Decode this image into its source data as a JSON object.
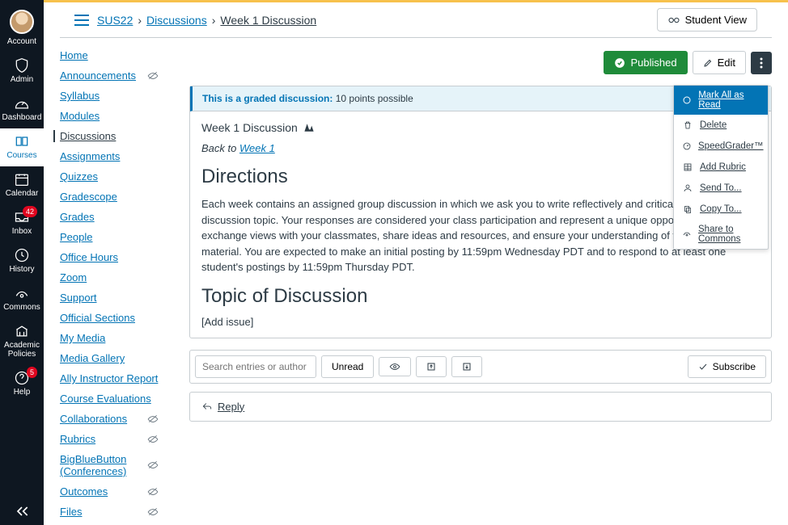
{
  "globalNav": {
    "account": "Account",
    "admin": "Admin",
    "dashboard": "Dashboard",
    "courses": "Courses",
    "calendar": "Calendar",
    "inbox": "Inbox",
    "inbox_badge": "42",
    "history": "History",
    "commons": "Commons",
    "academic": "Academic Policies",
    "help": "Help",
    "help_badge": "5"
  },
  "breadcrumbs": {
    "course": "SUS22",
    "section": "Discussions",
    "page": "Week 1 Discussion"
  },
  "studentView": "Student View",
  "courseNav": {
    "items": [
      {
        "label": "Home",
        "hidden": false
      },
      {
        "label": "Announcements",
        "hidden": true
      },
      {
        "label": "Syllabus",
        "hidden": false
      },
      {
        "label": "Modules",
        "hidden": false
      },
      {
        "label": "Discussions",
        "hidden": false,
        "active": true
      },
      {
        "label": "Assignments",
        "hidden": false
      },
      {
        "label": "Quizzes",
        "hidden": false
      },
      {
        "label": "Gradescope",
        "hidden": false
      },
      {
        "label": "Grades",
        "hidden": false
      },
      {
        "label": "People",
        "hidden": false
      },
      {
        "label": "Office Hours",
        "hidden": false
      },
      {
        "label": "Zoom",
        "hidden": false
      },
      {
        "label": "Support",
        "hidden": false
      },
      {
        "label": "Official Sections",
        "hidden": false
      },
      {
        "label": "My Media",
        "hidden": false
      },
      {
        "label": "Media Gallery",
        "hidden": false
      },
      {
        "label": "Ally Instructor Report",
        "hidden": false
      },
      {
        "label": "Course Evaluations",
        "hidden": false
      },
      {
        "label": "Collaborations",
        "hidden": true
      },
      {
        "label": "Rubrics",
        "hidden": true
      },
      {
        "label": "BigBlueButton (Conferences)",
        "hidden": true
      },
      {
        "label": "Outcomes",
        "hidden": true
      },
      {
        "label": "Files",
        "hidden": true
      }
    ]
  },
  "actions": {
    "published": "Published",
    "edit": "Edit"
  },
  "dropdown": {
    "markAll": "Mark All as Read",
    "delete": "Delete",
    "speedgrader": "SpeedGrader™",
    "addRubric": "Add Rubric",
    "sendTo": "Send To...",
    "copyTo": "Copy To...",
    "share": "Share to Commons"
  },
  "banner": {
    "prefix": "This is a graded discussion:",
    "points": " 10 points possible"
  },
  "discussion": {
    "title": "Week 1 Discussion",
    "backto_prefix": "Back to ",
    "backto_link": "Week 1",
    "directions_h": "Directions",
    "directions_body": "Each week contains an assigned group discussion in which we ask you to write reflectively and critically about the discussion topic. Your responses are considered your class participation and represent a unique opportunity for you to exchange views with your classmates, share ideas and resources, and ensure your understanding of the course material. You are expected to make an initial posting by 11:59pm Wednesday PDT and to respond to at least one student's postings by 11:59pm Thursday PDT.",
    "topic_h": "Topic of Discussion",
    "addissue": "[Add issue]"
  },
  "toolbar": {
    "search_placeholder": "Search entries or author",
    "unread": "Unread",
    "subscribe": "Subscribe"
  },
  "reply": "Reply"
}
